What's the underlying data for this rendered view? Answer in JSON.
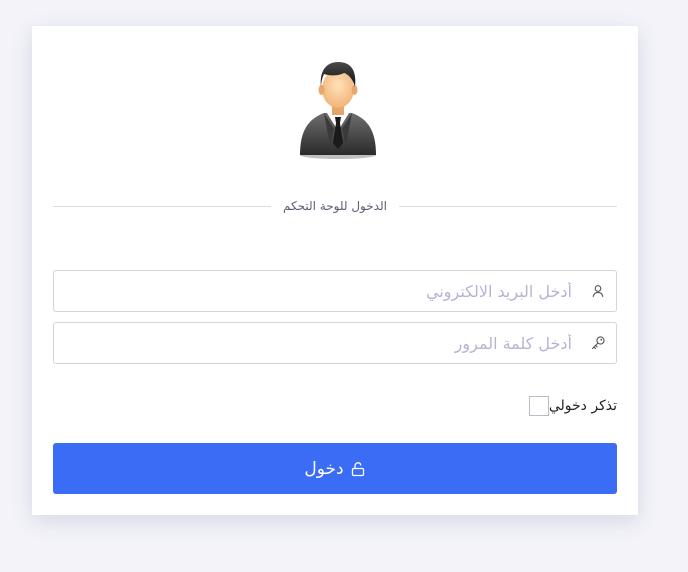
{
  "login": {
    "title": "الدخول للوحة التحكم",
    "email": {
      "placeholder": "أدخل البريد الالكتروني",
      "value": "",
      "icon": "user-icon"
    },
    "password": {
      "placeholder": "أدخل كلمة المرور",
      "value": "",
      "icon": "key-icon"
    },
    "remember": {
      "label": "تذكر دخولي",
      "checked": false
    },
    "submit": {
      "label": "دخول",
      "icon": "unlock-icon"
    },
    "avatar": {
      "icon": "businessman-avatar-icon"
    }
  },
  "colors": {
    "background": "#f3f3f9",
    "card": "#ffffff",
    "primary": "#3a6cf6",
    "placeholder": "#b7b3d4",
    "border": "#d2d4e0"
  }
}
